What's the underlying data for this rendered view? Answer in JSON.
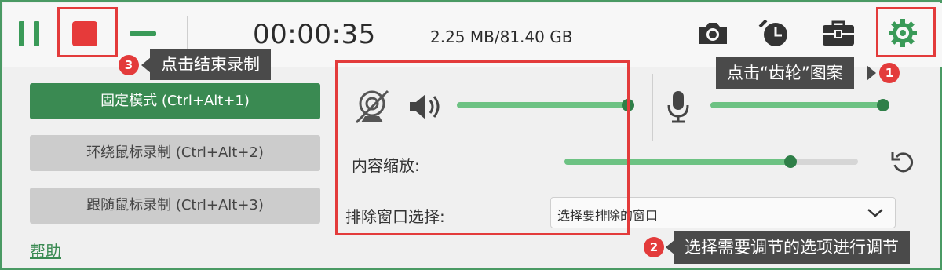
{
  "toolbar": {
    "timer": "00:00:35",
    "storage": "2.25 MB/81.40 GB",
    "icons": [
      "pause-icon",
      "stop-icon",
      "minimize-icon",
      "camera-icon",
      "alarm-clock-icon",
      "toolbox-icon",
      "gear-icon"
    ]
  },
  "modes": [
    {
      "label": "固定模式 (Ctrl+Alt+1)",
      "active": true
    },
    {
      "label": "环绕鼠标录制 (Ctrl+Alt+2)",
      "active": false
    },
    {
      "label": "跟随鼠标录制 (Ctrl+Alt+3)",
      "active": false
    }
  ],
  "help_label": "帮助",
  "audio": {
    "webcam_icon": "webcam-off-icon",
    "speaker_icon": "speaker-icon",
    "speaker_level": 0.99,
    "mic_icon": "microphone-icon",
    "mic_level": 1.0
  },
  "zoom": {
    "label": "内容缩放:",
    "level": 0.77,
    "reset_icon": "reset-icon"
  },
  "exclude": {
    "label": "排除窗口选择:",
    "value": "选择要排除的窗口"
  },
  "annotations": {
    "one": {
      "number": "1",
      "text": "点击“齿轮”图案"
    },
    "two": {
      "number": "2",
      "text": "选择需要调节的选项进行调节"
    },
    "three": {
      "number": "3",
      "text": "点击结束录制"
    }
  },
  "colors": {
    "accent": "#3a8a52",
    "slider": "#6dc283",
    "stop": "#e63a3a",
    "annotation": "#e33b3b"
  }
}
